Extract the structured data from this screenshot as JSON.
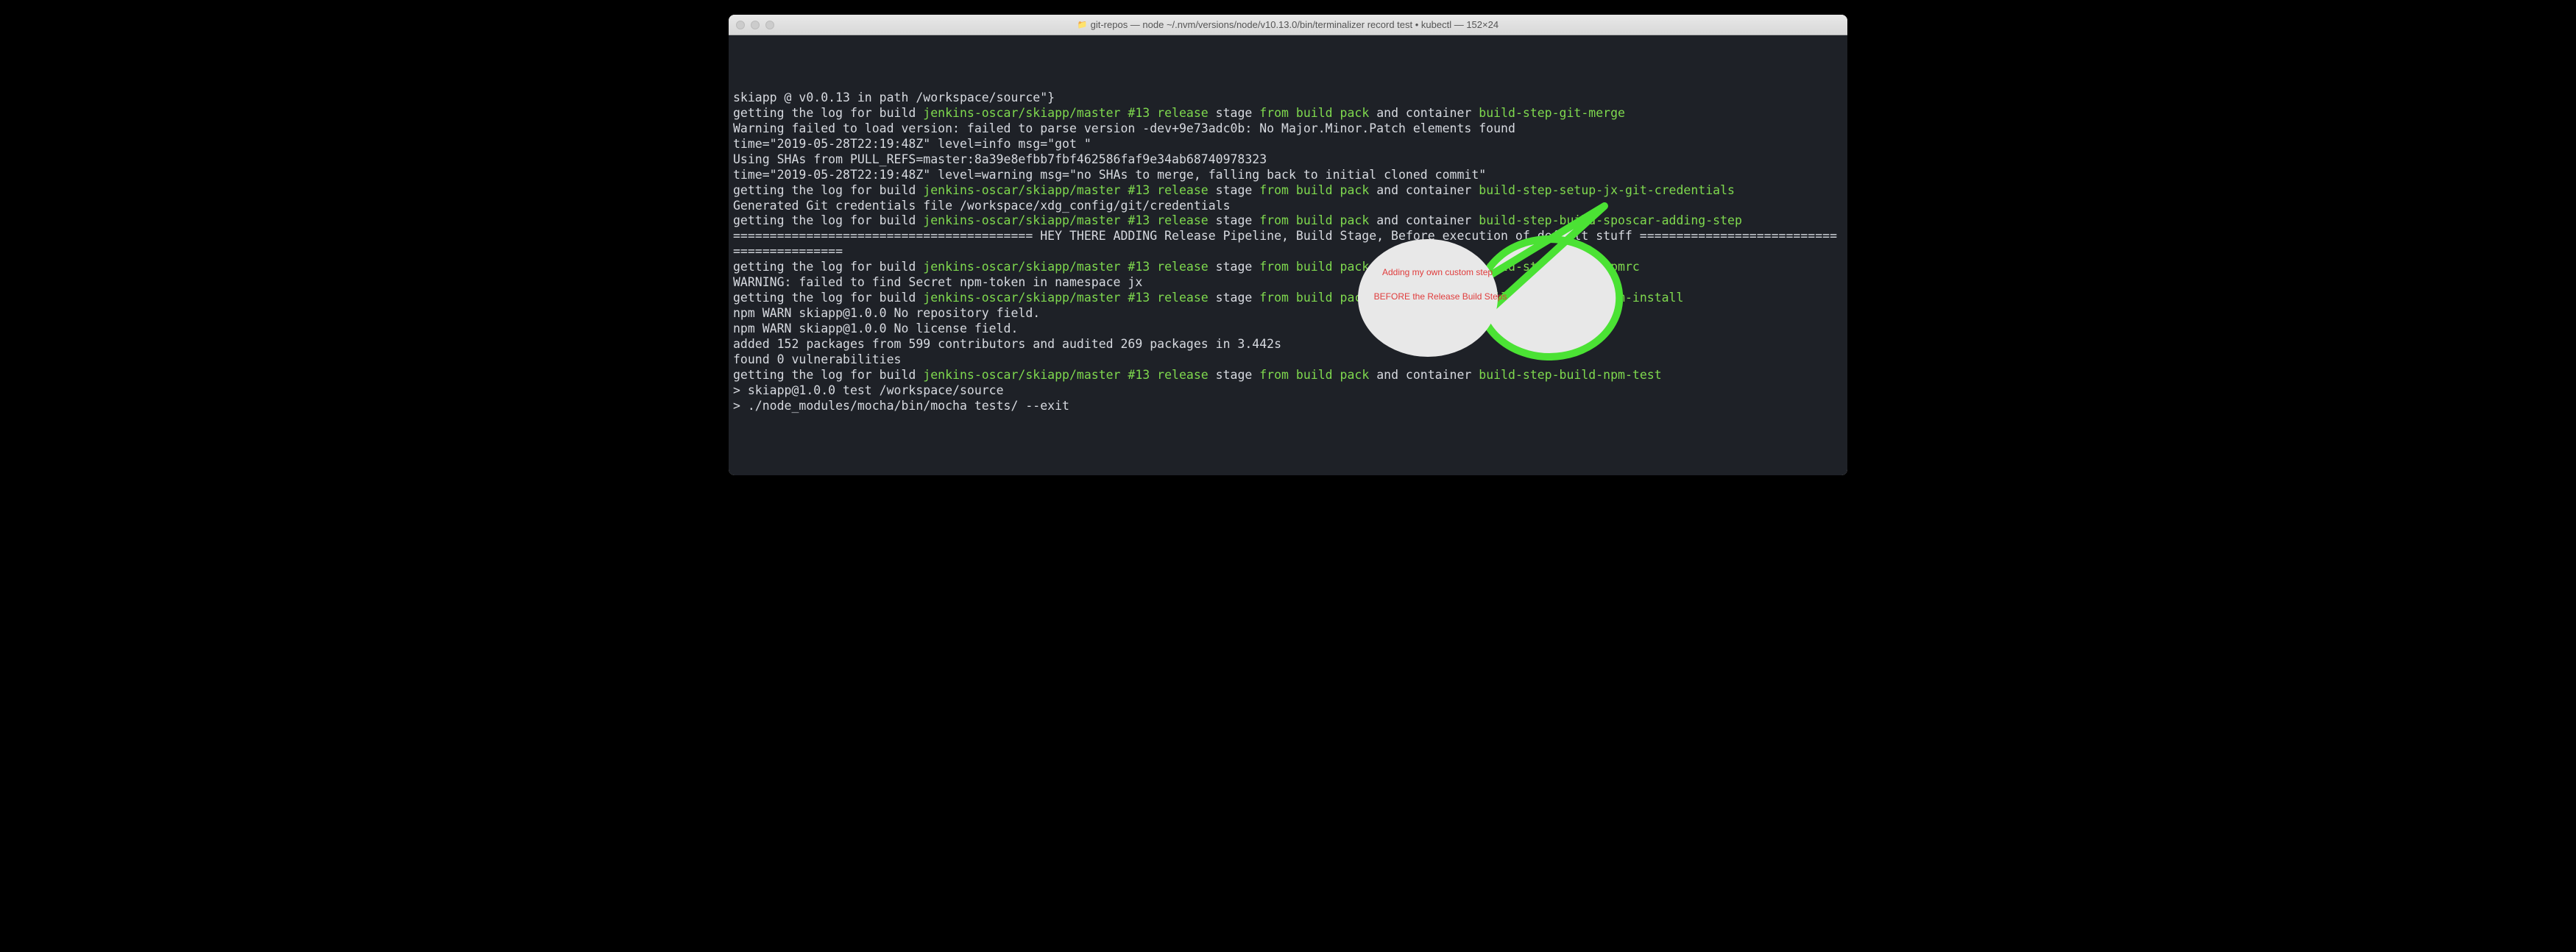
{
  "window": {
    "title": "git-repos — node ~/.nvm/versions/node/v10.13.0/bin/terminalizer record test • kubectl — 152×24"
  },
  "callout": {
    "line1": "Adding my own custom step",
    "line2": "BEFORE the Release Build Steps"
  },
  "colors": {
    "terminal_bg": "#1e2127",
    "text_default": "#d7dae0",
    "text_green": "#7fd94e",
    "callout_stroke": "#4be234",
    "callout_fill": "#e8e8e8",
    "callout_text": "#e03c3c"
  },
  "lines": [
    {
      "segments": [
        {
          "c": "w",
          "t": "skiapp @ v0.0.13 in path /workspace/source\"}"
        }
      ]
    },
    {
      "segments": [
        {
          "c": "w",
          "t": "getting the log for build "
        },
        {
          "c": "g",
          "t": "jenkins-oscar/skiapp/master #13 release"
        },
        {
          "c": "w",
          "t": " stage "
        },
        {
          "c": "g",
          "t": "from build pack"
        },
        {
          "c": "w",
          "t": " and container "
        },
        {
          "c": "g",
          "t": "build-step-git-merge"
        }
      ]
    },
    {
      "segments": [
        {
          "c": "w",
          "t": "Warning failed to load version: failed to parse version -dev+9e73adc0b: No Major.Minor.Patch elements found"
        }
      ]
    },
    {
      "segments": [
        {
          "c": "w",
          "t": "time=\"2019-05-28T22:19:48Z\" level=info msg=\"got \""
        }
      ]
    },
    {
      "segments": [
        {
          "c": "w",
          "t": "Using SHAs from PULL_REFS=master:8a39e8efbb7fbf462586faf9e34ab68740978323"
        }
      ]
    },
    {
      "segments": [
        {
          "c": "w",
          "t": "time=\"2019-05-28T22:19:48Z\" level=warning msg=\"no SHAs to merge, falling back to initial cloned commit\""
        }
      ]
    },
    {
      "segments": [
        {
          "c": "w",
          "t": "getting the log for build "
        },
        {
          "c": "g",
          "t": "jenkins-oscar/skiapp/master #13 release"
        },
        {
          "c": "w",
          "t": " stage "
        },
        {
          "c": "g",
          "t": "from build pack"
        },
        {
          "c": "w",
          "t": " and container "
        },
        {
          "c": "g",
          "t": "build-step-setup-jx-git-credentials"
        }
      ]
    },
    {
      "segments": [
        {
          "c": "w",
          "t": "Generated Git credentials file /workspace/xdg_config/git/credentials"
        }
      ]
    },
    {
      "segments": [
        {
          "c": "w",
          "t": "getting the log for build "
        },
        {
          "c": "g",
          "t": "jenkins-oscar/skiapp/master #13 release"
        },
        {
          "c": "w",
          "t": " stage "
        },
        {
          "c": "g",
          "t": "from build pack"
        },
        {
          "c": "w",
          "t": " and container "
        },
        {
          "c": "g",
          "t": "build-step-build-sposcar-adding-step"
        }
      ]
    },
    {
      "segments": [
        {
          "c": "w",
          "t": "========================================= HEY THERE ADDING Release Pipeline, Build Stage, Before execution of default stuff =========================================="
        }
      ]
    },
    {
      "segments": [
        {
          "c": "w",
          "t": "getting the log for build "
        },
        {
          "c": "g",
          "t": "jenkins-oscar/skiapp/master #13 release"
        },
        {
          "c": "w",
          "t": " stage "
        },
        {
          "c": "g",
          "t": "from build pack"
        },
        {
          "c": "w",
          "t": " and container "
        },
        {
          "c": "g",
          "t": "build-step-build-npmrc"
        }
      ]
    },
    {
      "segments": [
        {
          "c": "w",
          "t": "WARNING: failed to find Secret npm-token in namespace jx"
        }
      ]
    },
    {
      "segments": [
        {
          "c": "w",
          "t": "getting the log for build "
        },
        {
          "c": "g",
          "t": "jenkins-oscar/skiapp/master #13 release"
        },
        {
          "c": "w",
          "t": " stage "
        },
        {
          "c": "g",
          "t": "from build pack"
        },
        {
          "c": "w",
          "t": " and container "
        },
        {
          "c": "g",
          "t": "build-step-build-npm-install"
        }
      ]
    },
    {
      "segments": [
        {
          "c": "w",
          "t": "npm WARN skiapp@1.0.0 No repository field."
        }
      ]
    },
    {
      "segments": [
        {
          "c": "w",
          "t": "npm WARN skiapp@1.0.0 No license field."
        }
      ]
    },
    {
      "segments": [
        {
          "c": "w",
          "t": ""
        }
      ]
    },
    {
      "segments": [
        {
          "c": "w",
          "t": "added 152 packages from 599 contributors and audited 269 packages in 3.442s"
        }
      ]
    },
    {
      "segments": [
        {
          "c": "w",
          "t": "found 0 vulnerabilities"
        }
      ]
    },
    {
      "segments": [
        {
          "c": "w",
          "t": ""
        }
      ]
    },
    {
      "segments": [
        {
          "c": "w",
          "t": "getting the log for build "
        },
        {
          "c": "g",
          "t": "jenkins-oscar/skiapp/master #13 release"
        },
        {
          "c": "w",
          "t": " stage "
        },
        {
          "c": "g",
          "t": "from build pack"
        },
        {
          "c": "w",
          "t": " and container "
        },
        {
          "c": "g",
          "t": "build-step-build-npm-test"
        }
      ]
    },
    {
      "segments": [
        {
          "c": "w",
          "t": ""
        }
      ]
    },
    {
      "segments": [
        {
          "c": "w",
          "t": "> skiapp@1.0.0 test /workspace/source"
        }
      ]
    },
    {
      "segments": [
        {
          "c": "w",
          "t": "> ./node_modules/mocha/bin/mocha tests/ --exit"
        }
      ]
    }
  ]
}
